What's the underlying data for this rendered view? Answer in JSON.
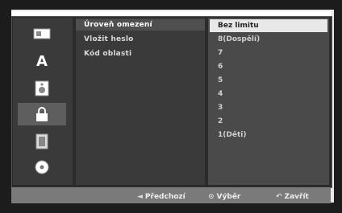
{
  "sidebar": {
    "items": [
      {
        "icon": "disc-settings-icon"
      },
      {
        "icon": "language-icon",
        "glyph": "A"
      },
      {
        "icon": "audio-speaker-icon"
      },
      {
        "icon": "lock-icon"
      },
      {
        "icon": "film-icon"
      },
      {
        "icon": "dvd-disc-icon"
      }
    ]
  },
  "menu": {
    "items": [
      {
        "label": "Úroveň omezení"
      },
      {
        "label": "Vložit heslo"
      },
      {
        "label": "Kód oblasti"
      }
    ]
  },
  "options": {
    "items": [
      {
        "label": "Bez limitu"
      },
      {
        "label": "8(Dospělí)"
      },
      {
        "label": "7"
      },
      {
        "label": "6"
      },
      {
        "label": "5"
      },
      {
        "label": "4"
      },
      {
        "label": "3"
      },
      {
        "label": "2"
      },
      {
        "label": "1(Děti)"
      }
    ]
  },
  "footer": {
    "prev": {
      "icon": "◄",
      "label": "Předchozí"
    },
    "select": {
      "icon": "⊙",
      "label": "Výběr"
    },
    "close": {
      "icon": "↶",
      "label": "Zavřít"
    }
  }
}
